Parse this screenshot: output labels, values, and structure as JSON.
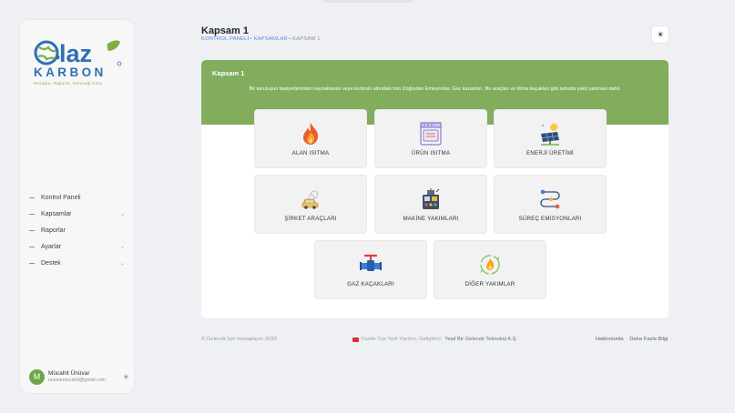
{
  "brand": {
    "line1": "alaz",
    "line2": "KARBON",
    "tagline": "Hesapla, Raporla, Geleceği Koru"
  },
  "sidebar": {
    "items": [
      {
        "label": "Kontrol Paneli",
        "chevron": false
      },
      {
        "label": "Kapsamlar",
        "chevron": true
      },
      {
        "label": "Raporlar",
        "chevron": false
      },
      {
        "label": "Ayarlar",
        "chevron": true
      },
      {
        "label": "Destek",
        "chevron": true
      }
    ]
  },
  "user": {
    "initial": "M",
    "name": "Mücahit Ünüvar",
    "email": "unuvarmucahit@gmail.com"
  },
  "header": {
    "title": "Kapsam 1",
    "breadcrumb": {
      "item1": "KONTROL PANELİ",
      "item2": "KAPSAMLAR",
      "separator": "•",
      "current": "KAPSAM 1"
    }
  },
  "banner": {
    "title": "Kapsam 1",
    "description": "Bir kuruluşun faaliyetlerinden kaynaklanan veya kontrolü altındaki tüm Doğrudan Emisyonlar. Gaz kazanları, filo araçları ve klima kaçakları gibi sahada yakıt yanması dahil."
  },
  "tiles": [
    {
      "label": "ALAN ISITMA",
      "icon": "flame-icon"
    },
    {
      "label": "ÜRÜN ISITMA",
      "icon": "oven-icon"
    },
    {
      "label": "ENERJİ ÜRETİMİ",
      "icon": "solar-panel-icon"
    },
    {
      "label": "ŞİRKET ARAÇLARI",
      "icon": "car-icon"
    },
    {
      "label": "MAKİNE YAKIMLARI",
      "icon": "machine-icon"
    },
    {
      "label": "SÜREÇ EMİSYONLARI",
      "icon": "process-icon"
    },
    {
      "label": "GAZ KAÇAKLARI",
      "icon": "valve-icon"
    },
    {
      "label": "DİĞER YAKIMLAR",
      "icon": "recycle-fire-icon"
    }
  ],
  "footer": {
    "left": "© Gelecek İçin Hesaplayın 2023",
    "mid": "Yüzde Yüz Yerli Yazılım. Geliştirici:",
    "company": "Yeşil Bir Gelecek Teknoloji A.Ş.",
    "links": [
      "Hakkımızda",
      "Daha Fazla Bilgi"
    ]
  },
  "colors": {
    "accent_green": "#82ad5d",
    "brand_blue": "#2f6fb6",
    "link_blue": "#5b8be0",
    "page_bg": "#eef0f3"
  }
}
